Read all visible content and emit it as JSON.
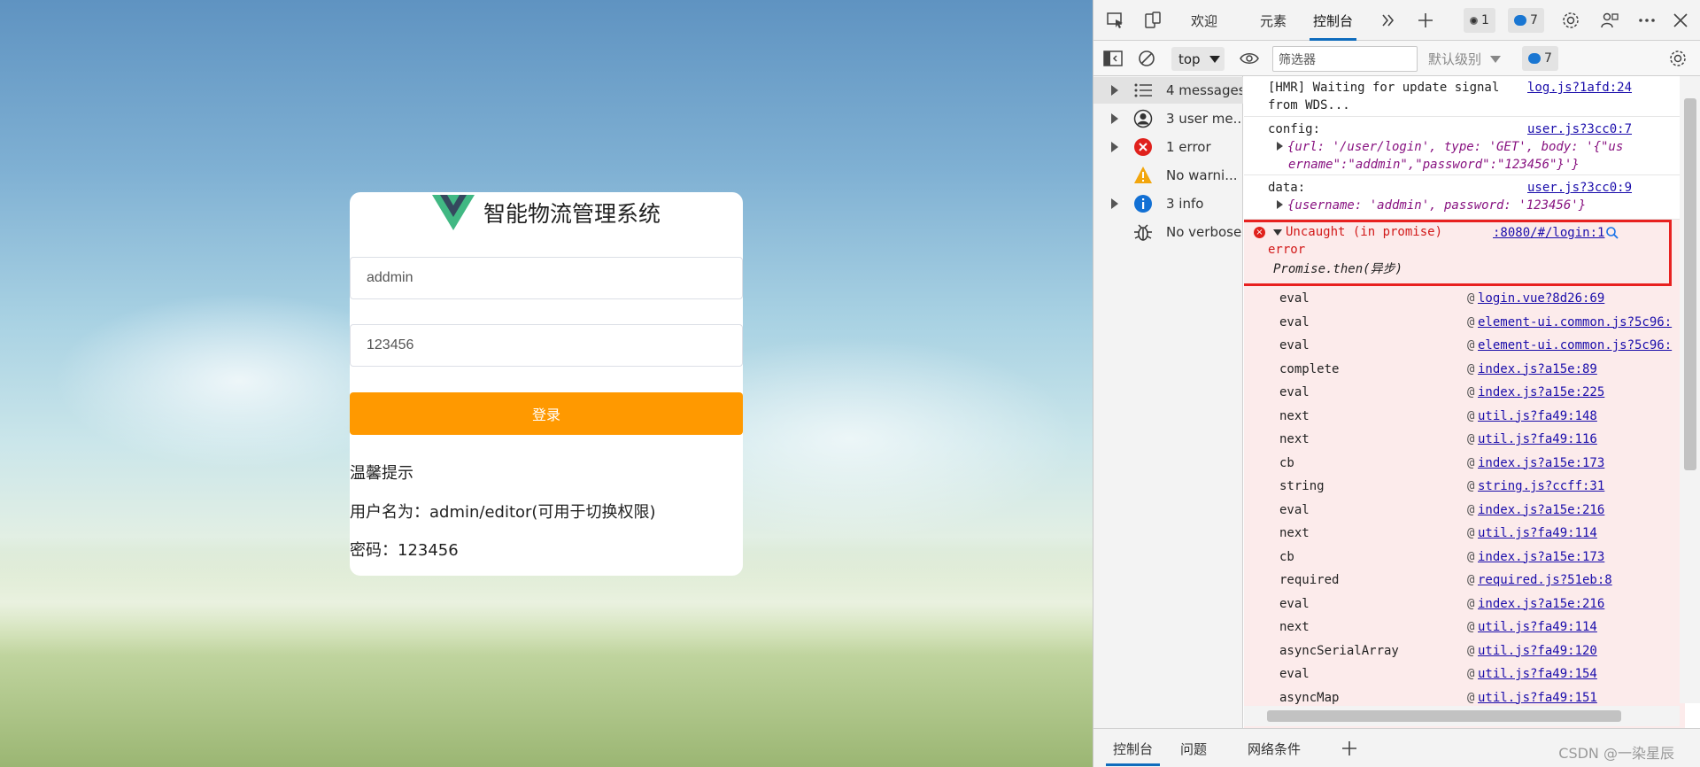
{
  "app": {
    "title": "智能物流管理系统",
    "username": "addmin",
    "password": "123456",
    "login_button": "登录",
    "tips": [
      "温馨提示",
      "用户名为：admin/editor(可用于切换权限)",
      "密码：123456"
    ]
  },
  "devtools": {
    "tabs": [
      "欢迎",
      "元素",
      "控制台"
    ],
    "active_tab": "控制台",
    "error_badge_count": "1",
    "message_badge_count": "7",
    "toolbar": {
      "context": "top",
      "filter_placeholder": "筛选器",
      "level": "默认级别",
      "issues_count": "7"
    },
    "sidebar": [
      {
        "label": "4 messages",
        "icon": "list-icon",
        "expandable": true
      },
      {
        "label": "3 user me...",
        "icon": "user-icon",
        "expandable": true
      },
      {
        "label": "1 error",
        "icon": "error-icon",
        "expandable": true
      },
      {
        "label": "No warni...",
        "icon": "warning-icon",
        "expandable": false
      },
      {
        "label": "3 info",
        "icon": "info-icon",
        "expandable": true
      },
      {
        "label": "No verbose",
        "icon": "bug-icon",
        "expandable": false
      }
    ],
    "logs": [
      {
        "lines": [
          "[HMR] Waiting for update signal",
          "from WDS..."
        ],
        "source": "log.js?1afd:24"
      },
      {
        "label": "config:",
        "source": "user.js?3cc0:7",
        "object": [
          "{url: '/user/login', type: 'GET', body: '{\"us",
          "ername\":\"addmin\",\"password\":\"123456\"}'}"
        ]
      },
      {
        "label": "data:",
        "source": "user.js?3cc0:9",
        "object": [
          "{username: 'addmin', password: '123456'}"
        ]
      }
    ],
    "error": {
      "title": "Uncaught (in promise)",
      "message": "error",
      "source": ":8080/#/login:1",
      "promise": "Promise.then(异步)",
      "stack": [
        {
          "fn": "eval",
          "src": "login.vue?8d26:69"
        },
        {
          "fn": "eval",
          "src": "element-ui.common.js?5c96:"
        },
        {
          "fn": "eval",
          "src": "element-ui.common.js?5c96:"
        },
        {
          "fn": "complete",
          "src": "index.js?a15e:89"
        },
        {
          "fn": "eval",
          "src": "index.js?a15e:225"
        },
        {
          "fn": "next",
          "src": "util.js?fa49:148"
        },
        {
          "fn": "next",
          "src": "util.js?fa49:116"
        },
        {
          "fn": "cb",
          "src": "index.js?a15e:173"
        },
        {
          "fn": "string",
          "src": "string.js?ccff:31"
        },
        {
          "fn": "eval",
          "src": "index.js?a15e:216"
        },
        {
          "fn": "next",
          "src": "util.js?fa49:114"
        },
        {
          "fn": "cb",
          "src": "index.js?a15e:173"
        },
        {
          "fn": "required",
          "src": "required.js?51eb:8"
        },
        {
          "fn": "eval",
          "src": "index.js?a15e:216"
        },
        {
          "fn": "next",
          "src": "util.js?fa49:114"
        },
        {
          "fn": "asyncSerialArray",
          "src": "util.js?fa49:120"
        },
        {
          "fn": "eval",
          "src": "util.js?fa49:154"
        },
        {
          "fn": "asyncMap",
          "src": "util.js?fa49:151"
        }
      ]
    },
    "drawer_tabs": [
      "控制台",
      "问题",
      "网络条件"
    ],
    "watermark": "CSDN @一染星辰"
  },
  "colors": {
    "login_button": "#ff9900",
    "error_text": "#d21a1a",
    "error_bg": "#fcebeb",
    "highlight_outline": "#e8201f",
    "link": "#1a0dab",
    "accent": "#0f6cbd"
  }
}
